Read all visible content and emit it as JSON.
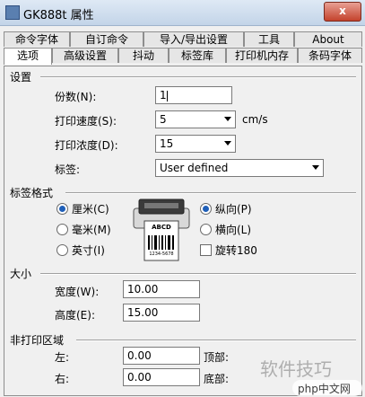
{
  "window": {
    "title": "GK888t 属性",
    "close_label": "x"
  },
  "tabs_row1": [
    "命令字体",
    "自订命令",
    "导入/导出设置",
    "工具",
    "About"
  ],
  "tabs_row2": [
    "选项",
    "高级设置",
    "抖动",
    "标签库",
    "打印机内存",
    "条码字体"
  ],
  "settings": {
    "title": "设置",
    "copies_label": "份数(N):",
    "copies_value": "1",
    "speed_label": "打印速度(S):",
    "speed_value": "5",
    "speed_unit": "cm/s",
    "darkness_label": "打印浓度(D):",
    "darkness_value": "15",
    "label_label": "标签:",
    "label_value": "User defined"
  },
  "format": {
    "title": "标签格式",
    "cm": "厘米(C)",
    "mm": "毫米(M)",
    "inch": "英寸(I)",
    "portrait": "纵向(P)",
    "landscape": "横向(L)",
    "rotate": "旋转180",
    "preview_text": "ABCD",
    "preview_num": "1234-5678",
    "unit_selected": "厘米(C)",
    "orientation_selected": "纵向(P)"
  },
  "size": {
    "title": "大小",
    "width_label": "宽度(W):",
    "width_value": "10.00",
    "height_label": "高度(E):",
    "height_value": "15.00"
  },
  "nonprint": {
    "title": "非打印区域",
    "left_label": "左:",
    "left_value": "0.00",
    "top_label": "顶部:",
    "right_label": "右:",
    "right_value": "0.00",
    "bottom_label": "底部:"
  },
  "watermark": {
    "text": "软件技巧",
    "badge": "php中文网"
  }
}
